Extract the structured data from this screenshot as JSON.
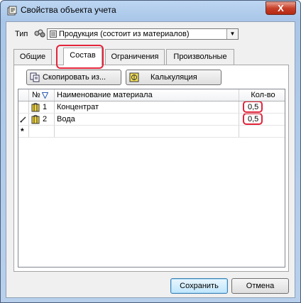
{
  "window": {
    "title": "Свойства объекта учета",
    "close_label": "X"
  },
  "type_field": {
    "label": "Тип",
    "value": "Продукция (состоит из материалов)"
  },
  "tabs": [
    {
      "label": "Общие",
      "active": false
    },
    {
      "label": "Состав",
      "active": true
    },
    {
      "label": "Ограничения",
      "active": false
    },
    {
      "label": "Произвольные",
      "active": false
    }
  ],
  "toolbar": {
    "copy_label": "Скопировать из...",
    "calc_label": "Калькуляция"
  },
  "grid": {
    "columns": {
      "num": "№",
      "name": "Наименование материала",
      "qty": "Кол-во"
    },
    "rows": [
      {
        "num": "1",
        "name": "Концентрат",
        "qty": "0,5",
        "editing": false
      },
      {
        "num": "2",
        "name": "Вода",
        "qty": "0,5",
        "editing": true
      }
    ],
    "new_row_marker": "*"
  },
  "footer": {
    "save_label": "Сохранить",
    "cancel_label": "Отмена"
  },
  "colors": {
    "highlight": "#e3243b",
    "close": "#c7402a"
  }
}
